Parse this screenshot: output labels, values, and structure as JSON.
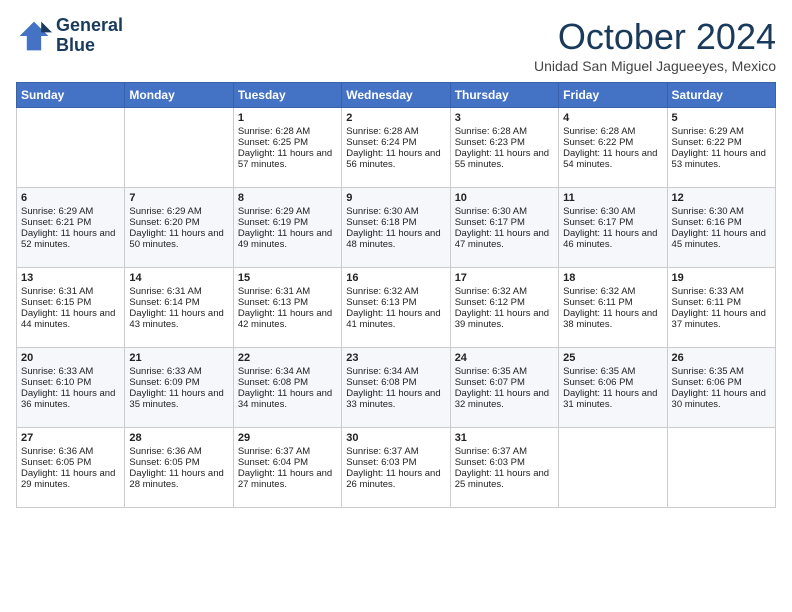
{
  "header": {
    "logo_line1": "General",
    "logo_line2": "Blue",
    "month_title": "October 2024",
    "subtitle": "Unidad San Miguel Jagueeyes, Mexico"
  },
  "days_of_week": [
    "Sunday",
    "Monday",
    "Tuesday",
    "Wednesday",
    "Thursday",
    "Friday",
    "Saturday"
  ],
  "weeks": [
    [
      {
        "day": "",
        "sunrise": "",
        "sunset": "",
        "daylight": ""
      },
      {
        "day": "",
        "sunrise": "",
        "sunset": "",
        "daylight": ""
      },
      {
        "day": "1",
        "sunrise": "Sunrise: 6:28 AM",
        "sunset": "Sunset: 6:25 PM",
        "daylight": "Daylight: 11 hours and 57 minutes."
      },
      {
        "day": "2",
        "sunrise": "Sunrise: 6:28 AM",
        "sunset": "Sunset: 6:24 PM",
        "daylight": "Daylight: 11 hours and 56 minutes."
      },
      {
        "day": "3",
        "sunrise": "Sunrise: 6:28 AM",
        "sunset": "Sunset: 6:23 PM",
        "daylight": "Daylight: 11 hours and 55 minutes."
      },
      {
        "day": "4",
        "sunrise": "Sunrise: 6:28 AM",
        "sunset": "Sunset: 6:22 PM",
        "daylight": "Daylight: 11 hours and 54 minutes."
      },
      {
        "day": "5",
        "sunrise": "Sunrise: 6:29 AM",
        "sunset": "Sunset: 6:22 PM",
        "daylight": "Daylight: 11 hours and 53 minutes."
      }
    ],
    [
      {
        "day": "6",
        "sunrise": "Sunrise: 6:29 AM",
        "sunset": "Sunset: 6:21 PM",
        "daylight": "Daylight: 11 hours and 52 minutes."
      },
      {
        "day": "7",
        "sunrise": "Sunrise: 6:29 AM",
        "sunset": "Sunset: 6:20 PM",
        "daylight": "Daylight: 11 hours and 50 minutes."
      },
      {
        "day": "8",
        "sunrise": "Sunrise: 6:29 AM",
        "sunset": "Sunset: 6:19 PM",
        "daylight": "Daylight: 11 hours and 49 minutes."
      },
      {
        "day": "9",
        "sunrise": "Sunrise: 6:30 AM",
        "sunset": "Sunset: 6:18 PM",
        "daylight": "Daylight: 11 hours and 48 minutes."
      },
      {
        "day": "10",
        "sunrise": "Sunrise: 6:30 AM",
        "sunset": "Sunset: 6:17 PM",
        "daylight": "Daylight: 11 hours and 47 minutes."
      },
      {
        "day": "11",
        "sunrise": "Sunrise: 6:30 AM",
        "sunset": "Sunset: 6:17 PM",
        "daylight": "Daylight: 11 hours and 46 minutes."
      },
      {
        "day": "12",
        "sunrise": "Sunrise: 6:30 AM",
        "sunset": "Sunset: 6:16 PM",
        "daylight": "Daylight: 11 hours and 45 minutes."
      }
    ],
    [
      {
        "day": "13",
        "sunrise": "Sunrise: 6:31 AM",
        "sunset": "Sunset: 6:15 PM",
        "daylight": "Daylight: 11 hours and 44 minutes."
      },
      {
        "day": "14",
        "sunrise": "Sunrise: 6:31 AM",
        "sunset": "Sunset: 6:14 PM",
        "daylight": "Daylight: 11 hours and 43 minutes."
      },
      {
        "day": "15",
        "sunrise": "Sunrise: 6:31 AM",
        "sunset": "Sunset: 6:13 PM",
        "daylight": "Daylight: 11 hours and 42 minutes."
      },
      {
        "day": "16",
        "sunrise": "Sunrise: 6:32 AM",
        "sunset": "Sunset: 6:13 PM",
        "daylight": "Daylight: 11 hours and 41 minutes."
      },
      {
        "day": "17",
        "sunrise": "Sunrise: 6:32 AM",
        "sunset": "Sunset: 6:12 PM",
        "daylight": "Daylight: 11 hours and 39 minutes."
      },
      {
        "day": "18",
        "sunrise": "Sunrise: 6:32 AM",
        "sunset": "Sunset: 6:11 PM",
        "daylight": "Daylight: 11 hours and 38 minutes."
      },
      {
        "day": "19",
        "sunrise": "Sunrise: 6:33 AM",
        "sunset": "Sunset: 6:11 PM",
        "daylight": "Daylight: 11 hours and 37 minutes."
      }
    ],
    [
      {
        "day": "20",
        "sunrise": "Sunrise: 6:33 AM",
        "sunset": "Sunset: 6:10 PM",
        "daylight": "Daylight: 11 hours and 36 minutes."
      },
      {
        "day": "21",
        "sunrise": "Sunrise: 6:33 AM",
        "sunset": "Sunset: 6:09 PM",
        "daylight": "Daylight: 11 hours and 35 minutes."
      },
      {
        "day": "22",
        "sunrise": "Sunrise: 6:34 AM",
        "sunset": "Sunset: 6:08 PM",
        "daylight": "Daylight: 11 hours and 34 minutes."
      },
      {
        "day": "23",
        "sunrise": "Sunrise: 6:34 AM",
        "sunset": "Sunset: 6:08 PM",
        "daylight": "Daylight: 11 hours and 33 minutes."
      },
      {
        "day": "24",
        "sunrise": "Sunrise: 6:35 AM",
        "sunset": "Sunset: 6:07 PM",
        "daylight": "Daylight: 11 hours and 32 minutes."
      },
      {
        "day": "25",
        "sunrise": "Sunrise: 6:35 AM",
        "sunset": "Sunset: 6:06 PM",
        "daylight": "Daylight: 11 hours and 31 minutes."
      },
      {
        "day": "26",
        "sunrise": "Sunrise: 6:35 AM",
        "sunset": "Sunset: 6:06 PM",
        "daylight": "Daylight: 11 hours and 30 minutes."
      }
    ],
    [
      {
        "day": "27",
        "sunrise": "Sunrise: 6:36 AM",
        "sunset": "Sunset: 6:05 PM",
        "daylight": "Daylight: 11 hours and 29 minutes."
      },
      {
        "day": "28",
        "sunrise": "Sunrise: 6:36 AM",
        "sunset": "Sunset: 6:05 PM",
        "daylight": "Daylight: 11 hours and 28 minutes."
      },
      {
        "day": "29",
        "sunrise": "Sunrise: 6:37 AM",
        "sunset": "Sunset: 6:04 PM",
        "daylight": "Daylight: 11 hours and 27 minutes."
      },
      {
        "day": "30",
        "sunrise": "Sunrise: 6:37 AM",
        "sunset": "Sunset: 6:03 PM",
        "daylight": "Daylight: 11 hours and 26 minutes."
      },
      {
        "day": "31",
        "sunrise": "Sunrise: 6:37 AM",
        "sunset": "Sunset: 6:03 PM",
        "daylight": "Daylight: 11 hours and 25 minutes."
      },
      {
        "day": "",
        "sunrise": "",
        "sunset": "",
        "daylight": ""
      },
      {
        "day": "",
        "sunrise": "",
        "sunset": "",
        "daylight": ""
      }
    ]
  ]
}
